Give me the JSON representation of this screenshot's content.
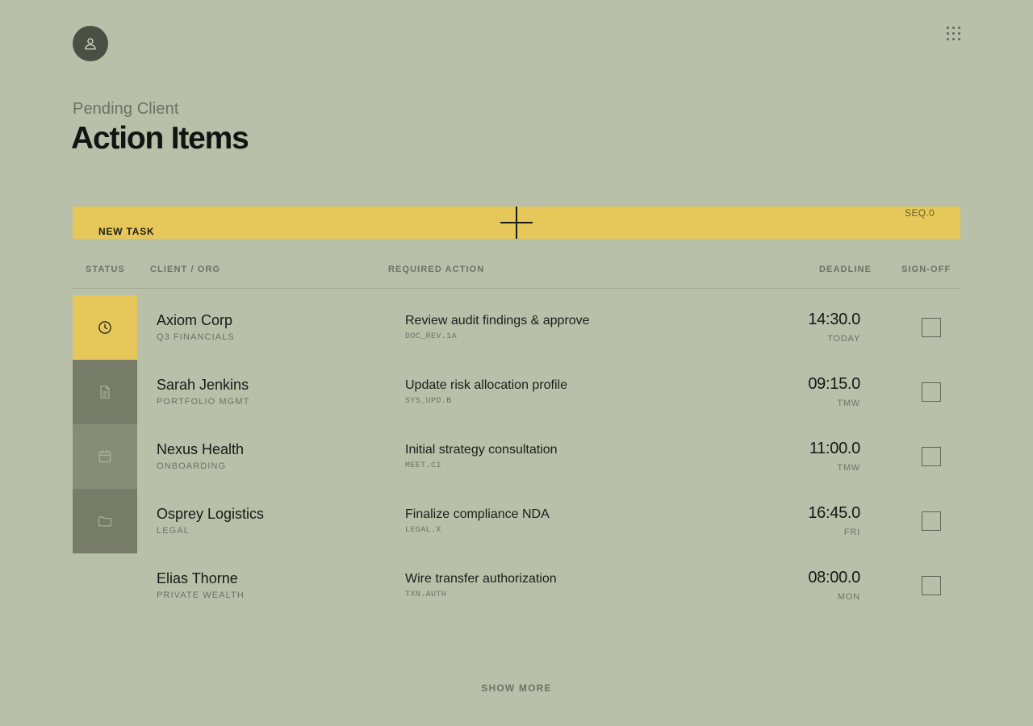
{
  "header": {
    "subtitle": "Pending Client",
    "title": "Action Items"
  },
  "toolbar": {
    "new_task_label": "NEW TASK",
    "sequence_label": "SEQ.0"
  },
  "table": {
    "columns": {
      "status": "STATUS",
      "client": "CLIENT / ORG",
      "action": "REQUIRED ACTION",
      "deadline": "DEADLINE",
      "signoff": "SIGN-OFF"
    },
    "rows": [
      {
        "client": "Axiom Corp",
        "org": "Q3 FINANCIALS",
        "action": "Review audit findings & approve",
        "code": "DOC_REV.1A",
        "time": "14:30.0",
        "day": "TODAY",
        "status_icon": "clock-icon",
        "status_color": "#e6c75a",
        "icon_color": "#1b1a10",
        "signed": false
      },
      {
        "client": "Sarah Jenkins",
        "org": "PORTFOLIO MGMT",
        "action": "Update risk allocation profile",
        "code": "SYS_UPD.B",
        "time": "09:15.0",
        "day": "TMW",
        "status_icon": "document-icon",
        "status_color": "#777c68",
        "icon_color": "#a8ae9a",
        "signed": false
      },
      {
        "client": "Nexus Health",
        "org": "ONBOARDING",
        "action": "Initial strategy consultation",
        "code": "MEET.C1",
        "time": "11:00.0",
        "day": "TMW",
        "status_icon": "calendar-icon",
        "status_color": "#868c76",
        "icon_color": "#aab09c",
        "signed": false
      },
      {
        "client": "Osprey Logistics",
        "org": "LEGAL",
        "action": "Finalize compliance NDA",
        "code": "LEGAL.X",
        "time": "16:45.0",
        "day": "FRI",
        "status_icon": "folder-icon",
        "status_color": "#777c68",
        "icon_color": "#a8ae9a",
        "signed": false
      },
      {
        "client": "Elias Thorne",
        "org": "PRIVATE WEALTH",
        "action": "Wire transfer authorization",
        "code": "TXN.AUTH",
        "time": "08:00.0",
        "day": "MON",
        "status_icon": "none",
        "status_color": "transparent",
        "icon_color": "transparent",
        "signed": false
      }
    ]
  },
  "footer": {
    "show_more_label": "SHOW MORE"
  },
  "colors": {
    "background": "#b8c0aa",
    "accent": "#e6c75a",
    "avatar": "#4a5044"
  }
}
